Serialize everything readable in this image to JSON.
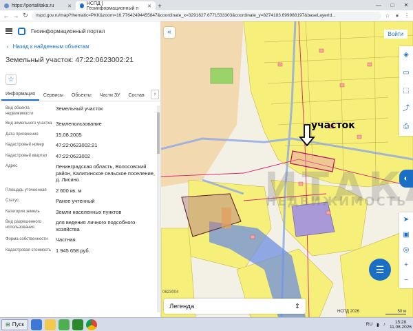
{
  "browser": {
    "tabs": [
      {
        "title": "https://portalitaka.ru",
        "active": false
      },
      {
        "title": "НСПД | Геоинформационный п",
        "active": true
      }
    ],
    "url": "nspd.gov.ru/map?thematic=PKK&zoom=16.77642494455847&coordinate_x=3291627.6771533303&coordinate_y=8274183.699988197&baseLayerId..."
  },
  "portal": {
    "title": "Геоинформационный портал",
    "back_label": "Назад к найденным объектам",
    "parcel_title": "Земельный участок: 47:22:0623002:21",
    "tabs": [
      "Информация",
      "Сервисы",
      "Объекты",
      "Части ЗУ",
      "Состав"
    ],
    "properties": [
      {
        "key": "Вид объекта недвижимости",
        "value": "Земельный участок"
      },
      {
        "key": "Вид земельного участка",
        "value": "Землепользование"
      },
      {
        "key": "Дата присвоения",
        "value": "15.08.2005"
      },
      {
        "key": "Кадастровый номер",
        "value": "47:22:0623002:21"
      },
      {
        "key": "Кадастровый квартал",
        "value": "47:22:0623002"
      },
      {
        "key": "Адрес",
        "value": "Ленинградская область, Волосовский район, Калитинское сельское поселение, д. Лисино"
      },
      {
        "key": "Площадь уточненная",
        "value": "2 600 кв. м"
      },
      {
        "key": "Статус",
        "value": "Ранее учтенный"
      },
      {
        "key": "Категория земель",
        "value": "Земли населенных пунктов"
      },
      {
        "key": "Вид разрешенного использования",
        "value": "для ведения личного подсобного хозяйства"
      },
      {
        "key": "Форма собственности",
        "value": "Частная"
      },
      {
        "key": "Кадастровая стоимость",
        "value": "1 945 658 руб."
      }
    ]
  },
  "map": {
    "login_label": "Войти",
    "annotation": "участок",
    "cadastral_label": "0623004",
    "legend_label": "Легенда",
    "copyright": "НСПД 2026",
    "scale": "50 м",
    "watermark_main": "ИТАКА",
    "watermark_sub": "НЕДВИЖИМОСТЬ"
  },
  "taskbar": {
    "start_label": "Пуск",
    "lang": "RU",
    "time": "15:28",
    "date": "11.08.2026"
  }
}
